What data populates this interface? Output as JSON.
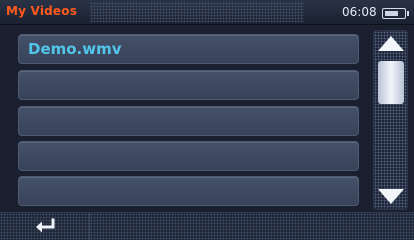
{
  "header": {
    "title": "My Videos",
    "time": "06:08",
    "battery_level": 0.75
  },
  "file_list": {
    "items": [
      "Demo.wmv",
      "",
      "",
      "",
      ""
    ]
  },
  "scrollbar": {
    "up_icon": "triangle-up",
    "down_icon": "triangle-down"
  },
  "footer": {
    "back_icon": "return-arrow"
  },
  "colors": {
    "title": "#ff5a1c",
    "file_text": "#52c5ea",
    "row_fill": "#3f4b62",
    "background": "#1a2030"
  }
}
